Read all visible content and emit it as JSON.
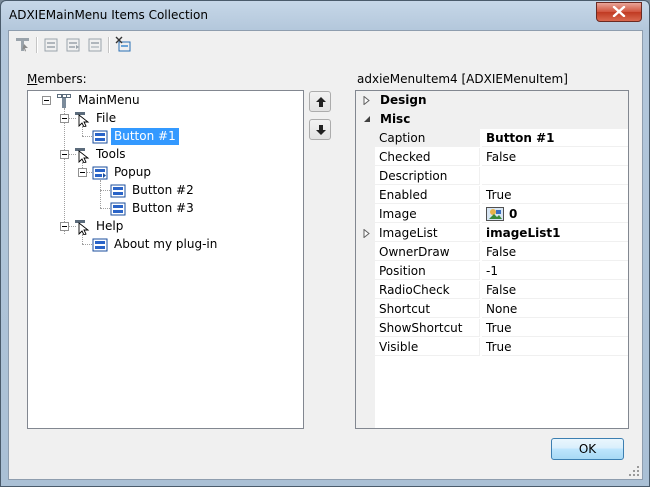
{
  "window": {
    "title": "ADXIEMainMenu Items Collection"
  },
  "toolbar": {
    "icons": [
      "add-menu-icon",
      "add-button-icon",
      "add-popup-icon",
      "add-separator-icon",
      "delete-icon"
    ]
  },
  "members": {
    "label_prefix": "M",
    "label_rest": "embers:",
    "tree": {
      "root": "MainMenu",
      "file": "File",
      "button1": "Button #1",
      "tools": "Tools",
      "popup": "Popup",
      "button2": "Button #2",
      "button3": "Button #3",
      "help": "Help",
      "about": "About my plug-in"
    }
  },
  "properties": {
    "header": "adxieMenuItem4 [ADXIEMenuItem]",
    "categories": {
      "design": "Design",
      "misc": "Misc"
    },
    "rows": [
      {
        "name": "Caption",
        "value": "Button #1",
        "bold": true
      },
      {
        "name": "Checked",
        "value": "False"
      },
      {
        "name": "Description",
        "value": ""
      },
      {
        "name": "Enabled",
        "value": "True"
      },
      {
        "name": "Image",
        "value": "0",
        "bold": true
      },
      {
        "name": "ImageList",
        "value": "imageList1",
        "bold": true
      },
      {
        "name": "OwnerDraw",
        "value": "False"
      },
      {
        "name": "Position",
        "value": "-1"
      },
      {
        "name": "RadioCheck",
        "value": "False"
      },
      {
        "name": "Shortcut",
        "value": "None"
      },
      {
        "name": "ShowShortcut",
        "value": "True"
      },
      {
        "name": "Visible",
        "value": "True"
      }
    ]
  },
  "buttons": {
    "ok": "OK"
  }
}
